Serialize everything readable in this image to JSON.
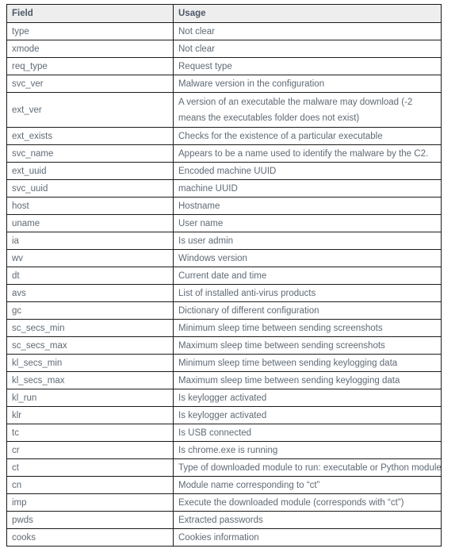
{
  "table": {
    "columns": [
      {
        "key": "field",
        "label": "Field"
      },
      {
        "key": "usage",
        "label": "Usage"
      }
    ],
    "header_background": "#eeeeee",
    "header_text_color": "#4c5866",
    "body_text_color": "#5f6a75",
    "border_color": "#1a1a1a",
    "rows": [
      {
        "field": "type",
        "usage": "Not clear"
      },
      {
        "field": "xmode",
        "usage": "Not clear"
      },
      {
        "field": "req_type",
        "usage": "Request type"
      },
      {
        "field": "svc_ver",
        "usage": "Malware version in the configuration"
      },
      {
        "field": "ext_ver",
        "usage": "A version of an executable the malware may download (-2 means the executables folder does not exist)",
        "tall": true
      },
      {
        "field": "ext_exists",
        "usage": "Checks for the existence of a particular executable"
      },
      {
        "field": "svc_name",
        "usage": "Appears to be a name used to identify the malware by the C2."
      },
      {
        "field": "ext_uuid",
        "usage": "Encoded machine UUID"
      },
      {
        "field": "svc_uuid",
        "usage": "machine UUID"
      },
      {
        "field": "host",
        "usage": "Hostname"
      },
      {
        "field": "uname",
        "usage": "User name"
      },
      {
        "field": "ia",
        "usage": "Is user admin"
      },
      {
        "field": "wv",
        "usage": "Windows version"
      },
      {
        "field": "dt",
        "usage": "Current date and time"
      },
      {
        "field": "avs",
        "usage": "List of installed anti-virus products"
      },
      {
        "field": "gc",
        "usage": "Dictionary of different configuration"
      },
      {
        "field": "sc_secs_min",
        "usage": "Minimum sleep time between sending screenshots"
      },
      {
        "field": "sc_secs_max",
        "usage": "Maximum sleep time between sending  screenshots"
      },
      {
        "field": "kl_secs_min",
        "usage": "Minimum sleep time between sending keylogging data"
      },
      {
        "field": "kl_secs_max",
        "usage": "Maximum sleep time between sending keylogging data"
      },
      {
        "field": "kl_run",
        "usage": "Is keylogger activated"
      },
      {
        "field": "klr",
        "usage": "Is keylogger activated"
      },
      {
        "field": "tc",
        "usage": "Is USB connected"
      },
      {
        "field": "cr",
        "usage": "Is chrome.exe is running"
      },
      {
        "field": "ct",
        "usage": "Type of downloaded module to run: executable or Python module"
      },
      {
        "field": "cn",
        "usage": "Module name corresponding to “ct”"
      },
      {
        "field": "imp",
        "usage": "Execute the downloaded module (corresponds with “ct”)"
      },
      {
        "field": "pwds",
        "usage": "Extracted passwords"
      },
      {
        "field": "cooks",
        "usage": "Cookies information"
      }
    ]
  }
}
